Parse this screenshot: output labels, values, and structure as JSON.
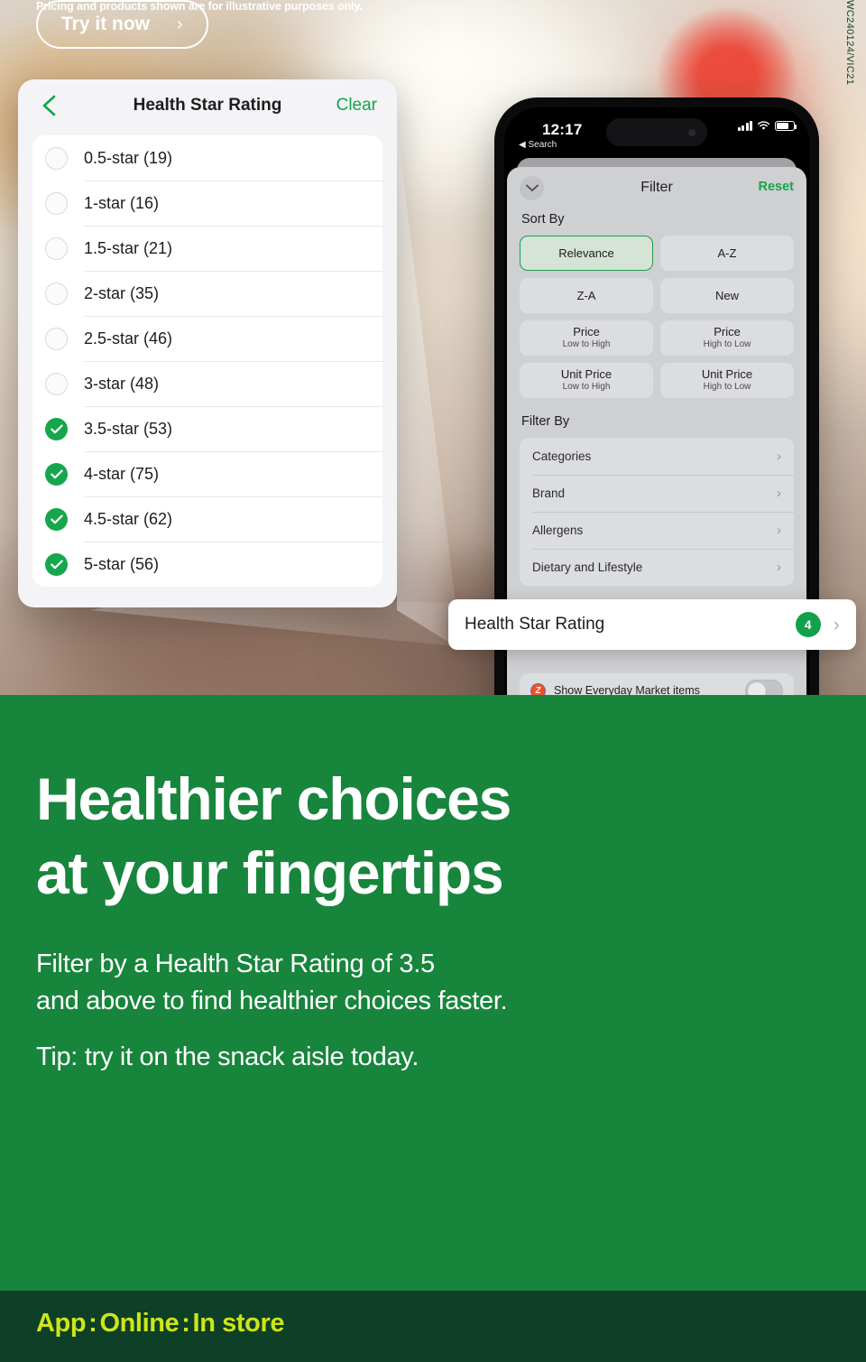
{
  "hero": {
    "zoom_card": {
      "back_icon": "chevron-left-icon",
      "title": "Health Star Rating",
      "clear_label": "Clear",
      "items": [
        {
          "label": "0.5-star (19)",
          "checked": false
        },
        {
          "label": "1-star (16)",
          "checked": false
        },
        {
          "label": "1.5-star (21)",
          "checked": false
        },
        {
          "label": "2-star (35)",
          "checked": false
        },
        {
          "label": "2.5-star (46)",
          "checked": false
        },
        {
          "label": "3-star (48)",
          "checked": false
        },
        {
          "label": "3.5-star (53)",
          "checked": true
        },
        {
          "label": "4-star (75)",
          "checked": true
        },
        {
          "label": "4.5-star (62)",
          "checked": true
        },
        {
          "label": "5-star (56)",
          "checked": true
        }
      ]
    },
    "phone": {
      "status_bar": {
        "time": "12:17",
        "back_to_app": "Search",
        "signal_icon": "cellular-bars-icon",
        "wifi_icon": "wifi-icon",
        "battery_icon": "battery-icon"
      },
      "sheet": {
        "collapse_icon": "chevron-down-icon",
        "title": "Filter",
        "reset_label": "Reset",
        "sort_by_label": "Sort By",
        "sort_options": [
          {
            "line1": "Relevance",
            "line2": "",
            "selected": true
          },
          {
            "line1": "A-Z",
            "line2": "",
            "selected": false
          },
          {
            "line1": "Z-A",
            "line2": "",
            "selected": false
          },
          {
            "line1": "New",
            "line2": "",
            "selected": false
          },
          {
            "line1": "Price",
            "line2": "Low to High",
            "selected": false
          },
          {
            "line1": "Price",
            "line2": "High to Low",
            "selected": false
          },
          {
            "line1": "Unit Price",
            "line2": "Low to High",
            "selected": false
          },
          {
            "line1": "Unit Price",
            "line2": "High to Low",
            "selected": false
          }
        ],
        "filter_by_label": "Filter By",
        "filter_rows": [
          {
            "name": "Categories",
            "chevron": "chevron-right-icon"
          },
          {
            "name": "Brand",
            "chevron": "chevron-right-icon"
          },
          {
            "name": "Allergens",
            "chevron": "chevron-right-icon"
          },
          {
            "name": "Dietary and Lifestyle",
            "chevron": "chevron-right-icon"
          }
        ],
        "everyday_market": {
          "icon": "everyday-market-icon",
          "label": "Show Everyday Market items",
          "toggle_on": false
        }
      }
    },
    "hsr_row": {
      "label": "Health Star Rating",
      "badge_count": "4",
      "chevron": "chevron-right-icon"
    }
  },
  "promo": {
    "headline_line1": "Healthier choices",
    "headline_line2": "at your fingertips",
    "body_line1": "Filter by a Health Star Rating of 3.5",
    "body_line2": "and above to find healthier choices faster.",
    "body_line3": "Tip: try it on the snack aisle today.",
    "cta_label": "Try it now",
    "cta_chevron": "chevron-right-icon",
    "legal": "Pricing and products shown are for illustrative purposes only.",
    "code": "WC240124/VIC21"
  },
  "footer": {
    "channels": [
      "App",
      "Online",
      "In store"
    ],
    "separator": ":"
  },
  "colors": {
    "brand_green": "#17853c",
    "dark_green": "#0d4026",
    "accent_yellow": "#cfe518",
    "check_green": "#16a64c",
    "badge_green": "#12a14b"
  }
}
